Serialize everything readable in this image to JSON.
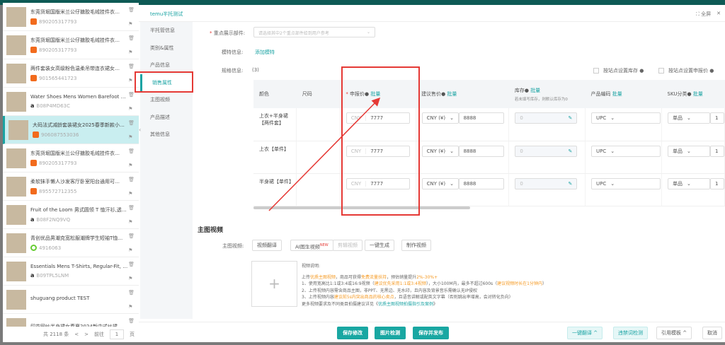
{
  "products": [
    {
      "title": "东莞货堀国版米兰公仔搪胶毛绒挂件衣…",
      "code": "890205317793",
      "src": "1688"
    },
    {
      "title": "东莞货堀国版米兰公仔搪胶毛绒挂件衣…",
      "code": "890205317793",
      "src": "1688"
    },
    {
      "title": "两件套装女高级粉色温柔吊带连衣裙女…",
      "code": "901565441723",
      "src": "1688"
    },
    {
      "title": "Water Shoes Mens Women Barefoot S…",
      "code": "B08P4MD63C",
      "src": "amazon"
    },
    {
      "title": "大码法式减龄套装裙女2025春季新款小…",
      "code": "906087553036",
      "src": "1688",
      "selected": true
    },
    {
      "title": "东莞货堀国版米兰公仔搪胶毛绒挂件衣…",
      "code": "890205317793",
      "src": "1688"
    },
    {
      "title": "柔软抹手懒人沙发客厅卧室阳台通用可…",
      "code": "895572712355",
      "src": "1688"
    },
    {
      "title": "Fruit of the Loom 男式圆领 T 恤汗衫,透…",
      "code": "B08F2NQ9VQ",
      "src": "amazon"
    },
    {
      "title": "青创优品男潮克宽松服潮牌学生短袖T恤…",
      "code": "4916063",
      "src": "other"
    },
    {
      "title": "Essentials Mens T-Shirts, Regular-Fit, …",
      "code": "B09TPL5LNM",
      "src": "amazon"
    },
    {
      "title": "shuguang product TEST",
      "code": "",
      "src": "none"
    },
    {
      "title": "印花网纱半身裙女春夏2024新中式纱裙…",
      "code": "",
      "src": "none"
    }
  ],
  "pager": {
    "total": "共 2118 条",
    "prev": "<",
    "next": ">",
    "goto": "前往",
    "page": "1",
    "unit": "页"
  },
  "modal": {
    "tab": "temu半托测试",
    "fullscreen": "全屏",
    "close": "✕"
  },
  "nav": [
    "半托管信息",
    "类别&属性",
    "产品信息",
    "销售属性",
    "主图视频",
    "产品描述",
    "其他信息"
  ],
  "form": {
    "key_parts_label": "重点展示部件:",
    "key_parts_placeholder": "请选择其中2个重点部件给到用户参考",
    "model_label": "模特信息:",
    "model_add": "添加模特",
    "spec_label": "规格信息:",
    "spec_count": "(3)",
    "by_site_stock": "按站点设置库存",
    "by_site_price": "按站点设置申报价"
  },
  "table": {
    "headers": {
      "color": "颜色",
      "size": "尺码",
      "declared": "申报价",
      "suggest": "建议售价",
      "stock": "库存",
      "stock_hint": "若未填写库存，则默认库存为0",
      "code": "产品编码",
      "sku": "SKU分类",
      "batch": "批量"
    },
    "rows": [
      {
        "color": "上衣+半身裙【两件套】",
        "cur": "CNY",
        "declared": "7777",
        "suggest_cur": "CNY (¥)",
        "suggest": "8888",
        "stock": "0",
        "code_type": "UPC",
        "sku_type": "单品",
        "sku_qty": "1"
      },
      {
        "color": "上衣【单件】",
        "cur": "CNY",
        "declared": "7777",
        "suggest_cur": "CNY (¥)",
        "suggest": "8888",
        "stock": "0",
        "code_type": "UPC",
        "sku_type": "单品",
        "sku_qty": "1"
      },
      {
        "color": "半身裙【单件】",
        "cur": "CNY",
        "declared": "7777",
        "suggest_cur": "CNY (¥)",
        "suggest": "8888",
        "stock": "0",
        "code_type": "UPC",
        "sku_type": "单品",
        "sku_qty": "1"
      }
    ]
  },
  "video": {
    "section": "主图视频",
    "label": "主图视频:",
    "buttons": [
      "视频翻译",
      "AI图生视频",
      "剪辑视频",
      "一键生成",
      "制作视频"
    ],
    "new_badge": "NEW",
    "desc_title": "视频说明:",
    "l0a": "上传",
    "l0b": "优质主图视频",
    "l0c": "，商品可获得",
    "l0d": "免费流量扶持",
    "l0e": "，预估销量提升",
    "l0f": "2%-30%+",
    "l1a": "1、使用宽高比1:1或3:4或16:9视频（",
    "l1b": "建议优先采用1:1或3:4视频",
    "l1c": "），大小100M内，最多不超过600s（",
    "l1d": "建议视频时长在1分钟内",
    "l1e": "）",
    "l2": "2、上传视频内容需含商品主图，非PPT、无黑边、无水印，且内容及背景音乐需确认无IP侵权",
    "l3a": "3、上传视频内容",
    "l3b": "建议前5s内突出商品的核心卖点",
    "l3c": "，且语音讲解或配英文字幕（否则跳出率增高，会对转化负向）",
    "l4a": "更多视频要求及不同类目拍摄建议详见《",
    "l4b": "优质主图视频拍摄指引及案例",
    "l4c": "》"
  },
  "footer": {
    "save": "保存修改",
    "check_img": "图片检测",
    "save_publish": "保存并发布",
    "translate": "一键翻译 ^",
    "forbidden": "违禁词检测",
    "template": "引用模板 ^",
    "cancel": "取消"
  }
}
